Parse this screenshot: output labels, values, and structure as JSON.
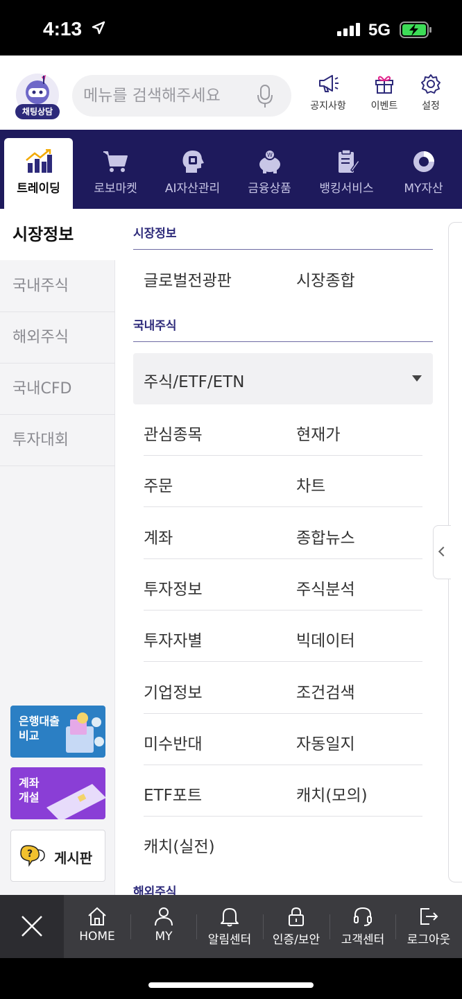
{
  "status_bar": {
    "time": "4:13",
    "network": "5G"
  },
  "header": {
    "chat_badge": "채팅상담",
    "search_placeholder": "메뉴를 검색해주세요",
    "buttons": [
      {
        "label": "공지사항",
        "icon": "megaphone-icon"
      },
      {
        "label": "이벤트",
        "icon": "gift-icon"
      },
      {
        "label": "설정",
        "icon": "gear-icon"
      }
    ]
  },
  "nav": {
    "tabs": [
      {
        "label": "트레이딩",
        "icon": "chart-icon",
        "active": true
      },
      {
        "label": "로보마켓",
        "icon": "cart-icon"
      },
      {
        "label": "AI자산관리",
        "icon": "ai-head-icon"
      },
      {
        "label": "금융상품",
        "icon": "piggy-bank-icon"
      },
      {
        "label": "뱅킹서비스",
        "icon": "clipboard-icon"
      },
      {
        "label": "MY자산",
        "icon": "donut-icon"
      }
    ]
  },
  "sidebar": {
    "items": [
      {
        "label": "시장정보",
        "active": true
      },
      {
        "label": "국내주식"
      },
      {
        "label": "해외주식"
      },
      {
        "label": "국내CFD"
      },
      {
        "label": "투자대회"
      }
    ],
    "banners": [
      {
        "text": "은행대출\n비교",
        "line1": "은행대출",
        "line2": "비교",
        "color": "#2b7fc4"
      },
      {
        "text": "계좌\n개설",
        "line1": "계좌",
        "line2": "개설",
        "color": "#8a3ed6"
      }
    ],
    "board_label": "게시판"
  },
  "content": {
    "market_info": {
      "title": "시장정보",
      "links": [
        "글로벌전광판",
        "시장종합"
      ]
    },
    "domestic": {
      "title": "국내주식",
      "dropdown": "주식/ETF/ETN",
      "links": [
        [
          "관심종목",
          "현재가"
        ],
        [
          "주문",
          "차트"
        ],
        [
          "계좌",
          "종합뉴스"
        ],
        [
          "투자정보",
          "주식분석"
        ],
        [
          "투자자별",
          "빅데이터"
        ],
        [
          "기업정보",
          "조건검색"
        ],
        [
          "미수반대",
          "자동일지"
        ],
        [
          "ETF포트",
          "캐치(모의)"
        ],
        [
          "캐치(실전)"
        ]
      ]
    },
    "overseas": {
      "title": "해외주식"
    }
  },
  "bottom_bar": {
    "items": [
      {
        "label": "HOME",
        "icon": "home-icon"
      },
      {
        "label": "MY",
        "icon": "user-icon"
      },
      {
        "label": "알림센터",
        "icon": "bell-icon"
      },
      {
        "label": "인증/보안",
        "icon": "lock-icon"
      },
      {
        "label": "고객센터",
        "icon": "headset-icon"
      },
      {
        "label": "로그아웃",
        "icon": "logout-icon"
      }
    ]
  },
  "colors": {
    "brand_navy": "#1e1a5c",
    "accent": "#2d2a7a",
    "bottom_bar": "#3b3b3f"
  }
}
